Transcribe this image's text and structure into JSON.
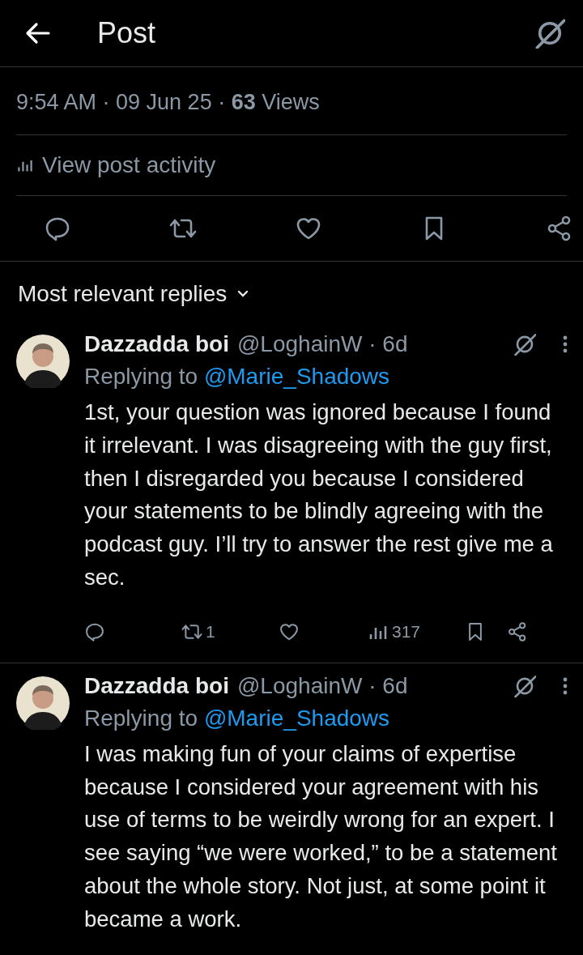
{
  "header": {
    "title": "Post"
  },
  "post_meta": "9:54 AM · 09 Jun 25 · **63** Views",
  "activity_link": "View post activity",
  "replies_sort": "Most relevant replies",
  "replies": [
    {
      "name": "Dazzadda boi",
      "handle_age": "@LoghainW · 6d",
      "replying_label": "Replying to",
      "replying_to": "@Marie_Shadows",
      "text": "1st, your question was ignored because I found it irrelevant. I was disagreeing with the guy first, then I disregarded you because I considered your statements to be blindly agreeing with the podcast guy. I’ll try to answer the rest give me a sec.",
      "stats": {
        "retweets": "1",
        "views": "317"
      }
    },
    {
      "name": "Dazzadda boi",
      "handle_age": "@LoghainW · 6d",
      "replying_label": "Replying to",
      "replying_to": "@Marie_Shadows",
      "text": "I was making fun of your claims of expertise because I considered your agreement with his use of terms to be weirdly wrong for an expert. I see saying “we were worked,” to be a statement about the whole story. Not just, at some point it became a work."
    }
  ]
}
